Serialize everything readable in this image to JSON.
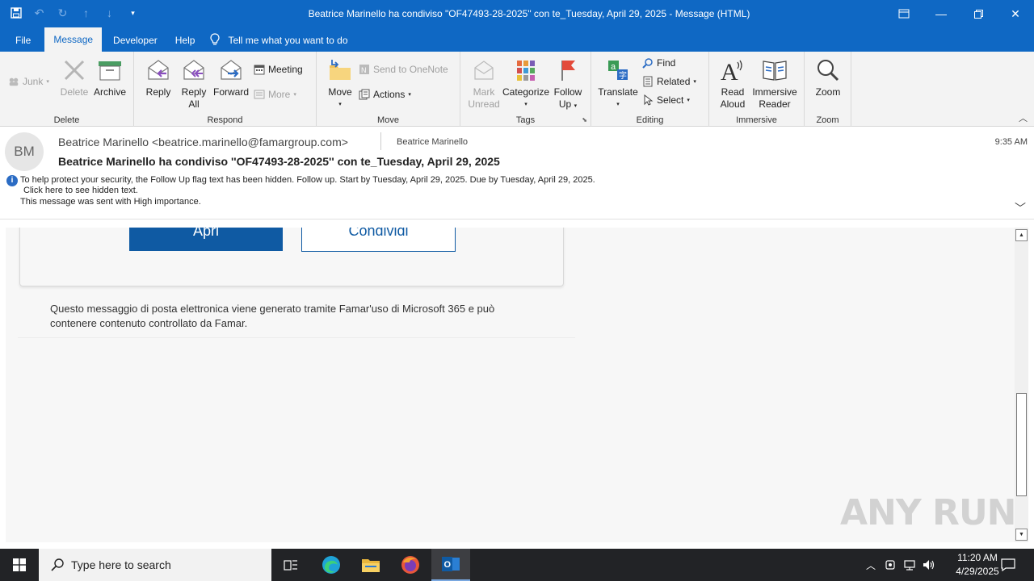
{
  "window": {
    "title": "Beatrice Marinello ha condiviso \"OF47493-28-2025\" con te_Tuesday, April 29, 2025  -  Message (HTML)"
  },
  "tabs": [
    {
      "label": "File"
    },
    {
      "label": "Message"
    },
    {
      "label": "Developer"
    },
    {
      "label": "Help"
    }
  ],
  "tellme": "Tell me what you want to do",
  "ribbon": {
    "delete": {
      "group": "Delete",
      "junk": "Junk",
      "delete": "Delete",
      "archive": "Archive"
    },
    "respond": {
      "group": "Respond",
      "reply": "Reply",
      "reply_all_1": "Reply",
      "reply_all_2": "All",
      "forward": "Forward",
      "meeting": "Meeting",
      "more": "More"
    },
    "move": {
      "group": "Move",
      "move": "Move",
      "onenote": "Send to OneNote",
      "actions": "Actions"
    },
    "tags": {
      "group": "Tags",
      "mark_unread_1": "Mark",
      "mark_unread_2": "Unread",
      "categorize": "Categorize",
      "follow_up_1": "Follow",
      "follow_up_2": "Up"
    },
    "editing": {
      "group": "Editing",
      "translate": "Translate",
      "find": "Find",
      "related": "Related",
      "select": "Select"
    },
    "immersive": {
      "group": "Immersive",
      "read_aloud_1": "Read",
      "read_aloud_2": "Aloud",
      "immersive_reader_1": "Immersive",
      "immersive_reader_2": "Reader"
    },
    "zoom": {
      "group": "Zoom",
      "zoom": "Zoom"
    }
  },
  "message": {
    "avatar_initials": "BM",
    "from": "Beatrice Marinello <beatrice.marinello@famargroup.com>",
    "to": "Beatrice Marinello",
    "time": "9:35 AM",
    "subject": "Beatrice Marinello ha condiviso ''OF47493-28-2025'' con te_Tuesday, April 29, 2025",
    "info_line1": "To help protect your security, the Follow Up flag text has been hidden. Follow up.  Start by Tuesday, April 29, 2025.  Due by Tuesday, April 29, 2025.",
    "info_line2": "Click here to see hidden text.",
    "info_line3": "This message was sent with High importance."
  },
  "body": {
    "open_button": "Apri",
    "share_button": "Condividi",
    "notice": "Questo messaggio di posta elettronica viene generato tramite Famar'uso di Microsoft 365 e può contenere contenuto controllato da Famar."
  },
  "watermark": "ANY RUN",
  "taskbar": {
    "search_placeholder": "Type here to search",
    "time": "11:20 AM",
    "date": "4/29/2025"
  },
  "colors": {
    "accent": "#0f68c4",
    "button": "#0f5aa3",
    "taskbar": "#222326"
  }
}
